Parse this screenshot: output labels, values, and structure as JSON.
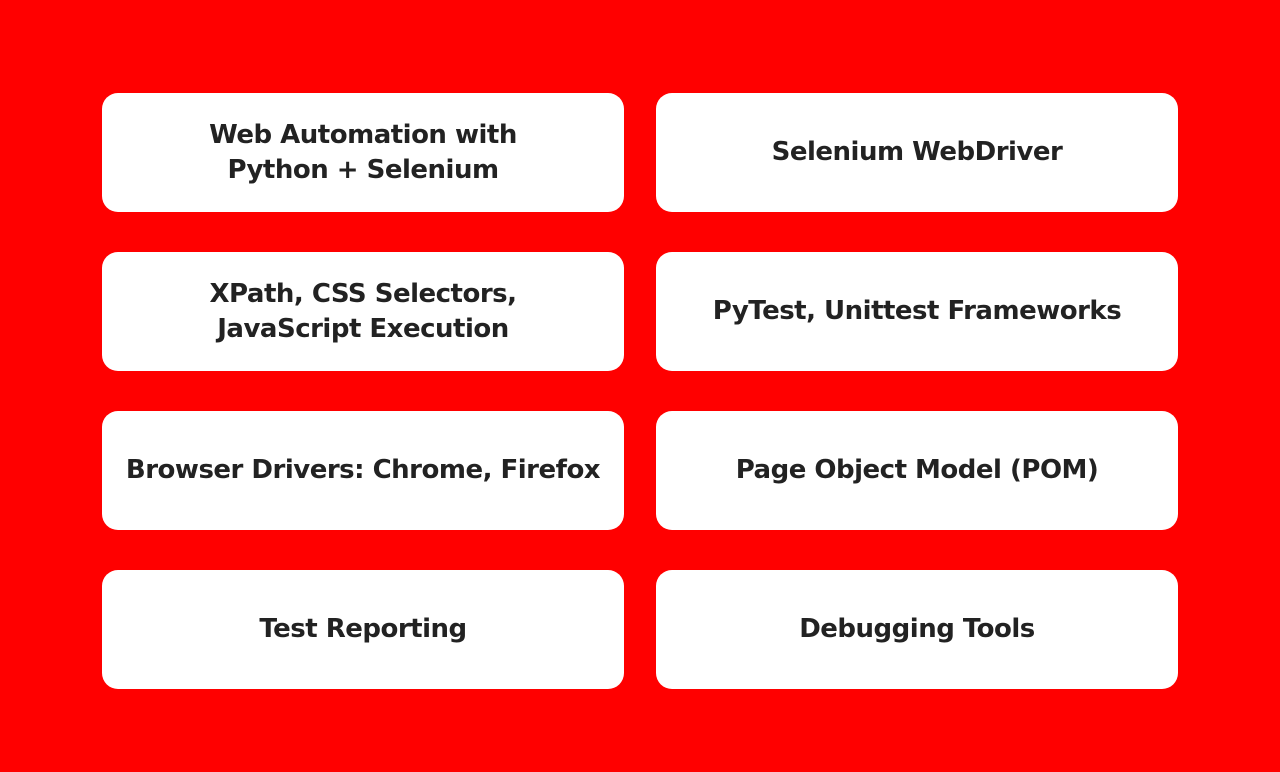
{
  "cards": [
    {
      "label": "Web Automation with\nPython + Selenium"
    },
    {
      "label": "Selenium WebDriver"
    },
    {
      "label": "XPath, CSS Selectors,\nJavaScript Execution"
    },
    {
      "label": "PyTest, Unittest Frameworks"
    },
    {
      "label": "Browser Drivers: Chrome, Firefox"
    },
    {
      "label": "Page Object Model (POM)"
    },
    {
      "label": "Test Reporting"
    },
    {
      "label": "Debugging Tools"
    }
  ],
  "colors": {
    "background": "#ff0000",
    "card": "#ffffff",
    "text": "#222222"
  }
}
